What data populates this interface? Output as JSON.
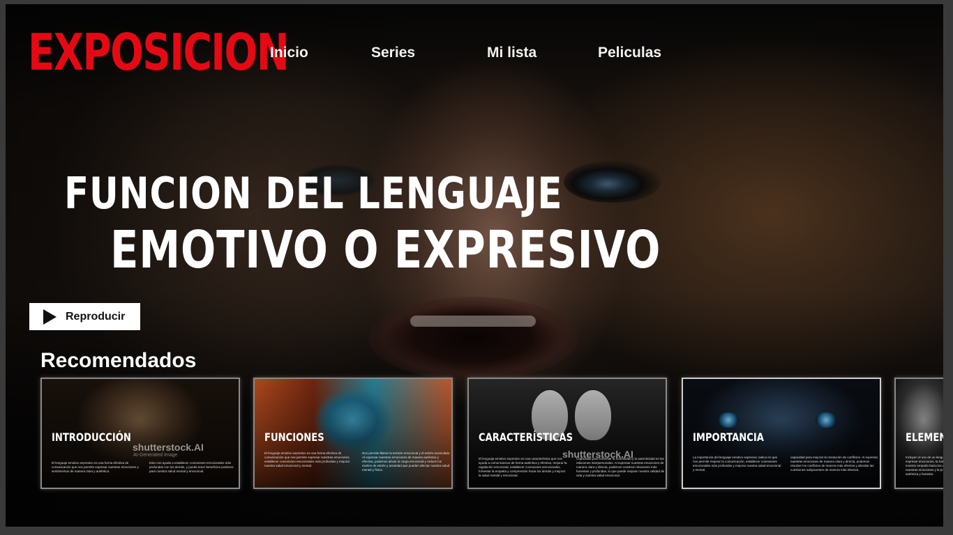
{
  "app": {
    "logo": "EXPOSICION"
  },
  "nav": {
    "items": [
      "Inicio",
      "Series",
      "Mi lista",
      "Peliculas"
    ]
  },
  "hero": {
    "title_line1": "FUNCION DEL LENGUAJE",
    "title_line2": "EMOTIVO O EXPRESIVO",
    "play_label": "Reproducir"
  },
  "section": {
    "title": "Recomendados"
  },
  "watermark": {
    "brand": "shutterstock.AI",
    "sub": "AI-Generated Image"
  },
  "cards": [
    {
      "title": "INTRODUCCIÓN",
      "text_a": "El lenguaje emotivo expresivo es una forma efectiva de comunicación que nos permite expresar nuestras emociones y sentimientos de manera clara y auténtica.",
      "text_b": "Esto nos ayuda a establecer conexiones emocionales más profundas con los demás, y puede tener beneficios positivos para nuestra salud mental y emocional."
    },
    {
      "title": "FUNCIONES",
      "text_a": "El lenguaje emotivo expresivo es una forma efectiva de comunicación que nos permite expresar nuestras emociones, establecer conexiones emocionales más profundas y mejorar nuestra salud emocional y mental.",
      "text_b": "Nos permite liberar la tensión emocional y el estrés acumulado. Al expresar nuestras emociones de manera auténtica y efectiva, podemos aliviar la carga emocional y reducir los niveles de estrés y ansiedad que pueden afectar nuestra salud mental y física."
    },
    {
      "title": "CARACTERÍSTICAS",
      "text_a": "El lenguaje emotivo expresivo es una característica que nos ayuda a comunicarnos de forma auténtica y efectiva, mejorar la regulación emocional, establecer conexiones emocionales, fomentar la empatía y comprensión hacia los demás y mejorar la salud mental y emocional.",
      "text_b": "Capacidad para fomentar la honestidad y la autenticidad en las relaciones interpersonales. Al expresar nuestras emociones de manera clara y directa, podemos construir relaciones más honestas y profundas, lo que puede mejorar nuestra calidad de vida y nuestra salud emocional."
    },
    {
      "title": "IMPORTANCIA",
      "text_a": "La importancia del lenguaje emotivo expresivo radica en que nos permite mejorar la comunicación, establecer conexiones emocionales más profundas y mejorar nuestra salud emocional y mental.",
      "text_b": "capacidad para mejorar la resolución de conflictos. Al expresar nuestras emociones de manera clara y directa, podemos resolver los conflictos de manera más efectiva y abordar las cuestiones subyacentes de manera más efectiva."
    },
    {
      "title": "ELEMENTOS",
      "text_a": "Incluyen el uso de un lenguaje claro y preciso para expresar emociones, la habilidad de escuchar activamente, mostrar empatía hacia los demás, la capacidad de regular nuestras emociones y la práctica de una comunicación auténtica y honesta.",
      "text_b": ""
    }
  ]
}
